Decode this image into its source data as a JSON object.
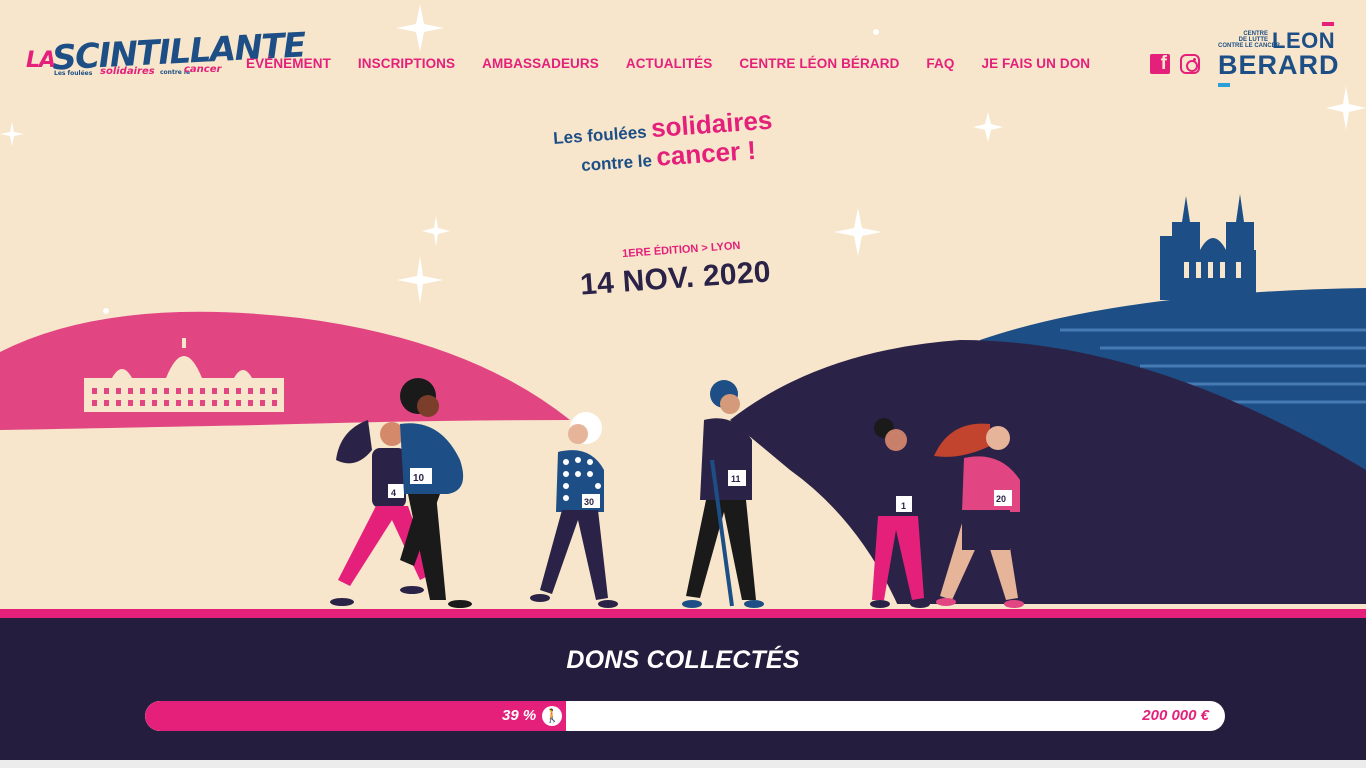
{
  "brand": {
    "logo_la": "LA",
    "logo_name": "SCINTILLANTE",
    "logo_sub1": "Les foulées",
    "logo_sub2": "solidaires",
    "logo_sub3": "contre le",
    "logo_sub4": "cancer"
  },
  "nav": {
    "items": [
      {
        "label": "EVÉNEMENT"
      },
      {
        "label": "INSCRIPTIONS"
      },
      {
        "label": "AMBASSADEURS"
      },
      {
        "label": "ACTUALITÉS"
      },
      {
        "label": "CENTRE LÉON BÉRARD"
      },
      {
        "label": "FAQ"
      },
      {
        "label": "JE FAIS UN DON"
      }
    ]
  },
  "social": {
    "facebook_icon": "facebook-icon",
    "instagram_icon": "instagram-icon"
  },
  "partner": {
    "small_l1": "CENTRE",
    "small_l2": "DE LUTTE",
    "small_l3": "CONTRE LE CANCER",
    "name_top": "LEON",
    "name_bottom": "BERARD"
  },
  "hero": {
    "tagline_a": "Les foulées ",
    "tagline_b": "solidaires",
    "tagline_c": "contre le ",
    "tagline_d": "cancer !",
    "edition": "1ERE ÉDITION > LYON",
    "date": "14 NOV. 2020"
  },
  "runners": {
    "bibs": [
      "4",
      "10",
      "30",
      "11",
      "1",
      "20"
    ]
  },
  "donations": {
    "title": "DONS COLLECTÉS",
    "percent_label": "39 %",
    "percent_value": 39,
    "goal": "200 000 €"
  },
  "colors": {
    "background": "#f7e6cb",
    "pink": "#e4207b",
    "navy": "#2b2347",
    "blue": "#1d4f86",
    "dark_band": "#251d3d"
  }
}
